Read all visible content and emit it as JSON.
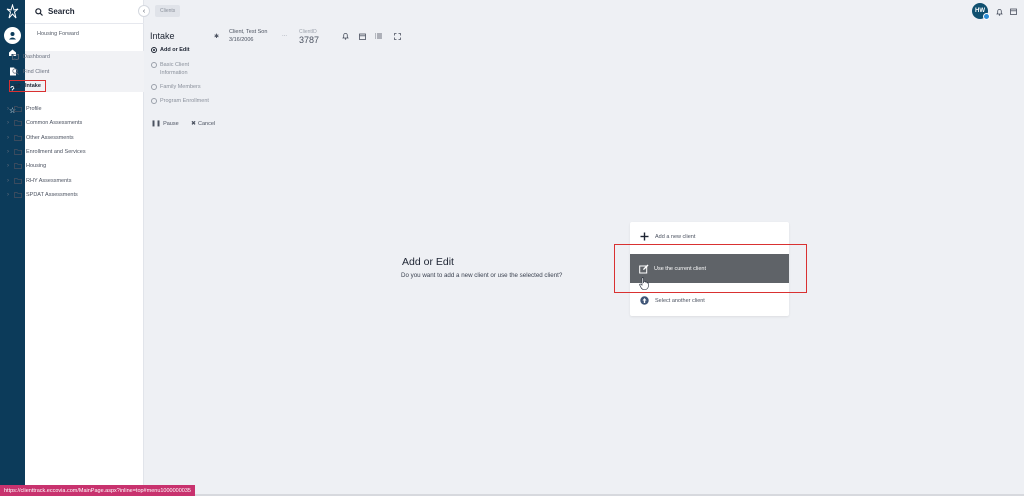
{
  "rail": {
    "icons": [
      "logo-icon",
      "user-circle-icon",
      "home-icon",
      "document-icon",
      "help-icon",
      "star-icon"
    ]
  },
  "search": {
    "label": "Search"
  },
  "panel": {
    "org": "Housing Forward",
    "nav": [
      {
        "label": "Dashboard",
        "icon": "map-icon"
      },
      {
        "label": "Find Client",
        "icon": "search-icon"
      },
      {
        "label": "Intake",
        "icon": "swap-icon"
      }
    ],
    "tree": [
      "Profile",
      "Common Assessments",
      "Other Assessments",
      "Enrollment and Services",
      "Housing",
      "RHY Assessments",
      "SPDAT Assessments"
    ]
  },
  "breadcrumb": {
    "label": "Clients"
  },
  "user": {
    "initials": "HW"
  },
  "workflow": {
    "title": "Intake",
    "client_name": "Client, Test Son",
    "client_dob": "3/16/2006",
    "ellipsis": "...",
    "client_id_label": "ClientID",
    "client_id": "3787",
    "steps": [
      {
        "label": "Add or Edit",
        "active": true
      },
      {
        "label": "Basic Client",
        "label2": "Information",
        "active": false
      },
      {
        "label": "Family Members",
        "active": false
      },
      {
        "label": "Program Enrollment",
        "active": false
      }
    ],
    "pause_label": "Pause",
    "cancel_label": "Cancel"
  },
  "main": {
    "title": "Add or Edit",
    "subtitle": "Do you want to add a new client or use the selected client?",
    "options": {
      "add_new": "Add a new client",
      "use_current": "Use the current client",
      "select_another": "Select another client"
    }
  },
  "status_url": "https://clienttrack.eccovia.com/MainPage.aspx?inline=top#menu1000000035",
  "colors": {
    "rail": "#0c3b5a",
    "accent": "#10506f",
    "highlight_box": "#d93131",
    "selected_option": "#5f6368",
    "status_bar": "#c8326e"
  }
}
